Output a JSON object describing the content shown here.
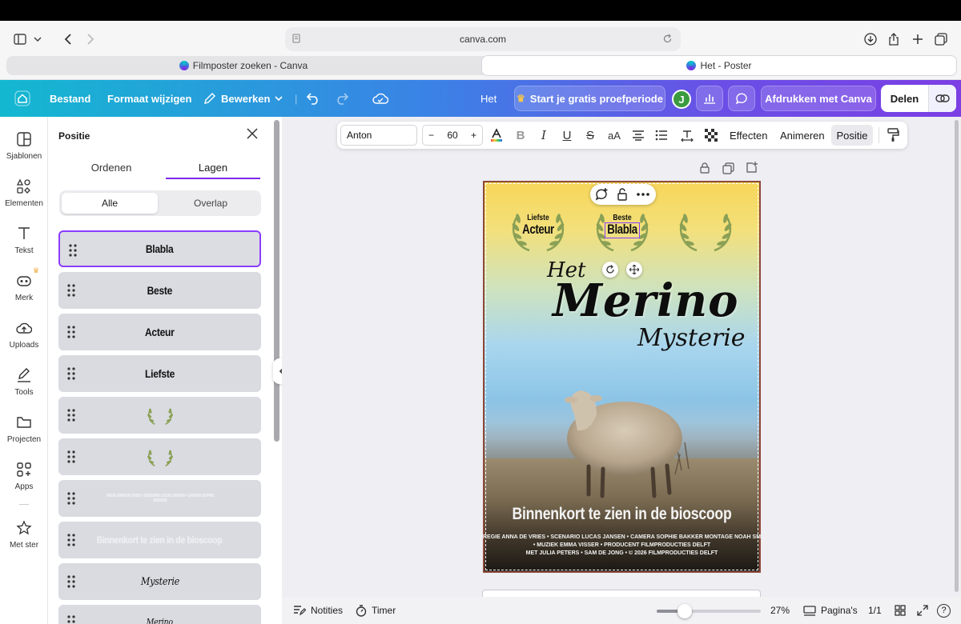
{
  "browser": {
    "url": "canva.com",
    "tabs": [
      {
        "label": "Filmposter zoeken - Canva",
        "active": false
      },
      {
        "label": "Het - Poster",
        "active": true
      }
    ]
  },
  "toolbar": {
    "file": "Bestand",
    "resize": "Formaat wijzigen",
    "edit": "Bewerken",
    "doc_title": "Het",
    "trial": "Start je gratis proefperiode",
    "avatar_initial": "J",
    "print": "Afdrukken met Canva",
    "share": "Delen"
  },
  "rail": {
    "items": [
      "Sjablonen",
      "Elementen",
      "Tekst",
      "Merk",
      "Uploads",
      "Tools",
      "Projecten",
      "Apps",
      "Met ster"
    ]
  },
  "panel": {
    "title": "Positie",
    "tabs": [
      "Ordenen",
      "Lagen"
    ],
    "active_tab": "Lagen",
    "filter": [
      "Alle",
      "Overlap"
    ],
    "active_filter": "Alle",
    "layers": [
      {
        "label": "Blabla",
        "kind": "text",
        "selected": true
      },
      {
        "label": "Beste",
        "kind": "text"
      },
      {
        "label": "Acteur",
        "kind": "text"
      },
      {
        "label": "Liefste",
        "kind": "text"
      },
      {
        "label": "",
        "kind": "wreath"
      },
      {
        "label": "",
        "kind": "wreath"
      },
      {
        "label": "REGIE ANNA DE VRIES • SCENARIO LUCAS JANSEN • CAMERA SOPHIE BAKKER",
        "kind": "faint"
      },
      {
        "label": "Binnenkort te zien in de bioscoop",
        "kind": "faint-big"
      },
      {
        "label": "Mysterie",
        "kind": "script"
      },
      {
        "label": "Merino",
        "kind": "script"
      }
    ]
  },
  "format_bar": {
    "font": "Anton",
    "size": "60",
    "effects": "Effecten",
    "animate": "Animeren",
    "position": "Positie"
  },
  "poster": {
    "laurels": [
      {
        "small": "Liefste",
        "big": "Acteur"
      },
      {
        "small": "Beste",
        "big": "Blabla"
      },
      {
        "small": "",
        "big": ""
      }
    ],
    "title_het": "Het",
    "title_merino": "Merino",
    "title_mysterie": "Mysterie",
    "tagline": "Binnenkort te zien in de bioscoop",
    "credits": [
      "REGIE ANNA DE VRIES • SCENARIO LUCAS JANSEN • CAMERA SOPHIE BAKKER MONTAGE NOAH SMIT",
      "• MUZIEK EMMA VISSER • PRODUCENT FILMPRODUCTIES DELFT",
      "MET JULIA PETERS • SAM DE JONG • © 2026 FILMPRODUCTIES DELFT"
    ]
  },
  "bottom": {
    "notes": "Notities",
    "timer": "Timer",
    "zoom": "27%",
    "zoom_level": 0.27,
    "pages": "Pagina's",
    "page_count": "1/1",
    "help": "?"
  },
  "colors": {
    "accent": "#7d2ae8",
    "laurel": "#8aa055",
    "avatar": "#3b9b3f"
  }
}
